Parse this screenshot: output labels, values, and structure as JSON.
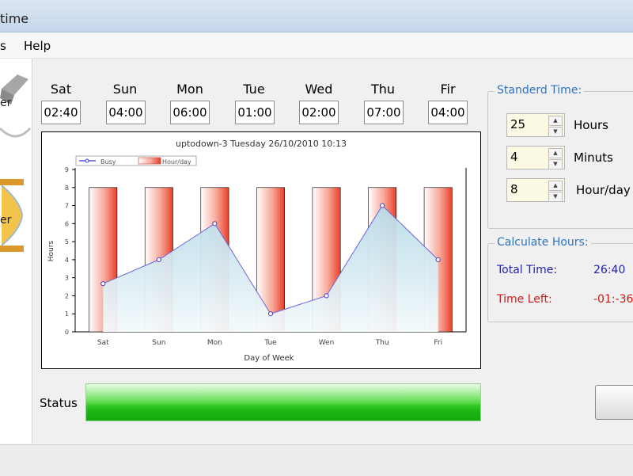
{
  "window": {
    "title": "time"
  },
  "menu": {
    "items": [
      "s",
      "Help"
    ]
  },
  "left_panel": {
    "labels": [
      "er",
      "er"
    ]
  },
  "days": [
    {
      "label": "Sat",
      "value": "02:40"
    },
    {
      "label": "Sun",
      "value": "04:00"
    },
    {
      "label": "Mon",
      "value": "06:00"
    },
    {
      "label": "Tue",
      "value": "01:00"
    },
    {
      "label": "Wed",
      "value": "02:00"
    },
    {
      "label": "Thu",
      "value": "07:00"
    },
    {
      "label": "Fir",
      "value": "04:00"
    }
  ],
  "standard_time": {
    "title": "Standerd Time:",
    "hours_value": "25",
    "hours_label": "Hours",
    "minutes_value": "4",
    "minutes_label": "Minuts",
    "hour_day_value": "8",
    "hour_day_label": "Hour/day"
  },
  "calculate": {
    "title": "Calculate Hours:",
    "total_label": "Total Time:",
    "total_value": "26:40",
    "left_label": "Time Left:",
    "left_value": "-01:-36"
  },
  "status": {
    "label": "Status",
    "progress": 1.0
  },
  "colors": {
    "accent_blue": "#2e74c0",
    "total_color": "#1f1fa8",
    "left_color": "#cc1b1b",
    "bar_red": "#e8402a",
    "area_fill": "#cfe8f1",
    "line_color": "#7a6ee0",
    "progress_green": "#1fba16"
  },
  "chart_data": {
    "type": "bar",
    "title": "uptodown-3 Tuesday 26/10/2010 10:13",
    "xlabel": "Day of Week",
    "ylabel": "Hours",
    "ylim": [
      0,
      9
    ],
    "yticks": [
      "0",
      "1",
      "2",
      "3",
      "4",
      "5",
      "6",
      "7",
      "8",
      "9"
    ],
    "categories": [
      "Sat",
      "Sun",
      "Mon",
      "Tue",
      "Wen",
      "Thu",
      "Fri"
    ],
    "legend_position": "top-left",
    "series": [
      {
        "name": "Busy",
        "type": "area",
        "values": [
          2.67,
          4,
          6,
          1,
          2,
          7,
          4
        ]
      },
      {
        "name": "Hour/day",
        "type": "bar",
        "values": [
          8,
          8,
          8,
          8,
          8,
          8,
          8
        ]
      }
    ]
  }
}
